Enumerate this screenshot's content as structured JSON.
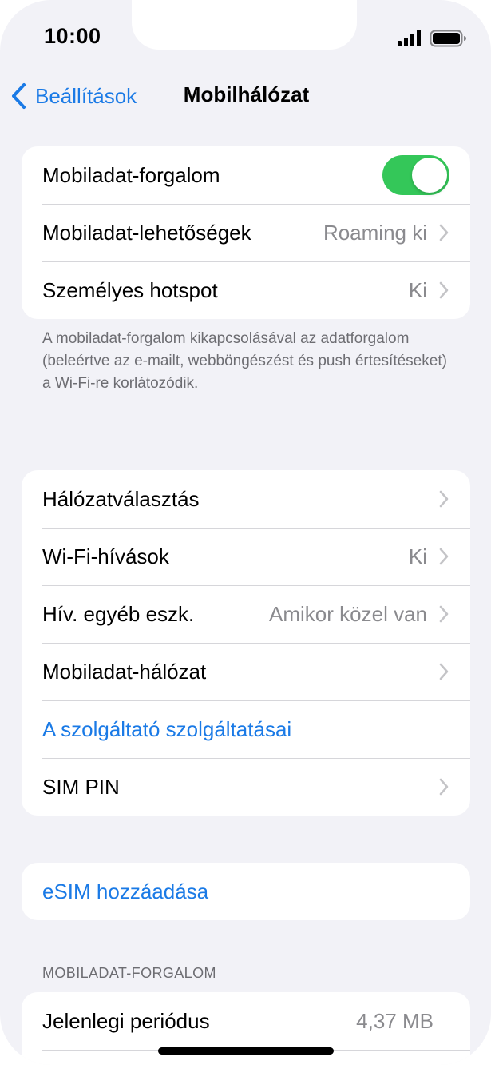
{
  "status_bar": {
    "time": "10:00",
    "signal_icon": "cellular-signal-icon",
    "battery_icon": "battery-icon"
  },
  "nav": {
    "back_label": "Beállítások",
    "title": "Mobilhálózat"
  },
  "group1": {
    "mobile_data": {
      "label": "Mobiladat-forgalom",
      "toggle_on": true
    },
    "data_options": {
      "label": "Mobiladat-lehetőségek",
      "value": "Roaming ki"
    },
    "hotspot": {
      "label": "Személyes hotspot",
      "value": "Ki"
    }
  },
  "group1_footer": "A mobiladat-forgalom kikapcsolásával az adatforgalom (beleértve az e-mailt, webböngészést és push értesítéseket) a Wi-Fi-re korlátozódik.",
  "group2": {
    "network_selection": {
      "label": "Hálózatválasztás"
    },
    "wifi_calling": {
      "label": "Wi-Fi-hívások",
      "value": "Ki"
    },
    "calls_other_devices": {
      "label": "Hív. egyéb eszk.",
      "value": "Amikor közel van"
    },
    "mobile_data_network": {
      "label": "Mobiladat-hálózat"
    },
    "carrier_services": {
      "label": "A szolgáltató szolgáltatásai"
    },
    "sim_pin": {
      "label": "SIM PIN"
    }
  },
  "group3": {
    "add_esim": {
      "label": "eSIM hozzáadása"
    }
  },
  "usage_section": {
    "header": "MOBILADAT-FORGALOM",
    "current_period": {
      "label": "Jelenlegi periódus",
      "value": "4,37 MB"
    }
  },
  "colors": {
    "accent_blue": "#1a7ae6",
    "toggle_green": "#34c759",
    "background": "#f2f2f7"
  }
}
